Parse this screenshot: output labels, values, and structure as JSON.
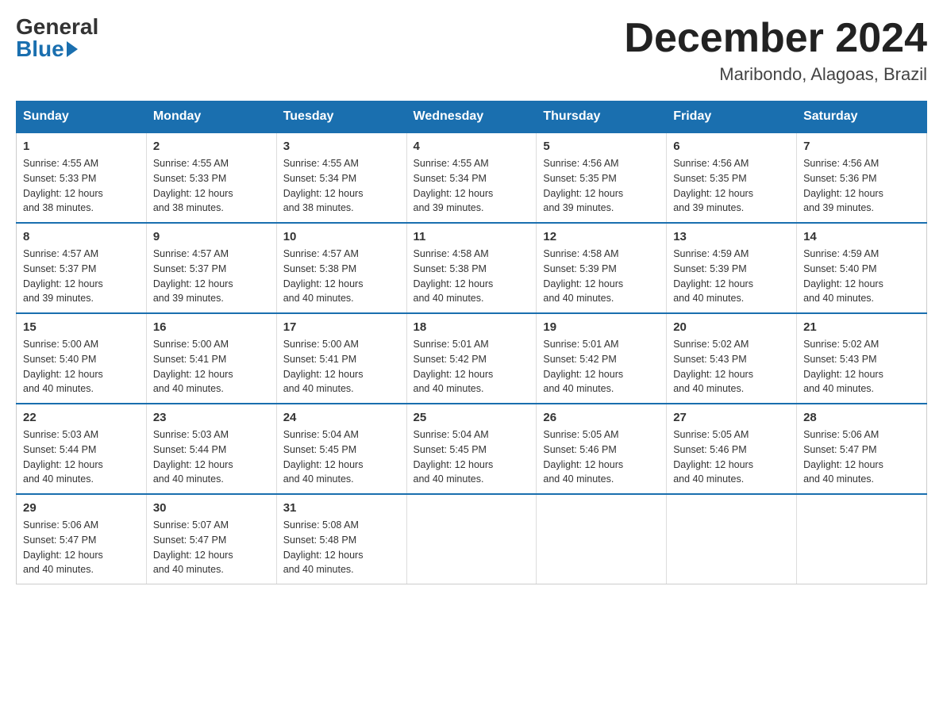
{
  "header": {
    "logo_general": "General",
    "logo_blue": "Blue",
    "main_title": "December 2024",
    "subtitle": "Maribondo, Alagoas, Brazil"
  },
  "days_of_week": [
    "Sunday",
    "Monday",
    "Tuesday",
    "Wednesday",
    "Thursday",
    "Friday",
    "Saturday"
  ],
  "weeks": [
    [
      {
        "day": "1",
        "sunrise": "4:55 AM",
        "sunset": "5:33 PM",
        "daylight": "12 hours and 38 minutes."
      },
      {
        "day": "2",
        "sunrise": "4:55 AM",
        "sunset": "5:33 PM",
        "daylight": "12 hours and 38 minutes."
      },
      {
        "day": "3",
        "sunrise": "4:55 AM",
        "sunset": "5:34 PM",
        "daylight": "12 hours and 38 minutes."
      },
      {
        "day": "4",
        "sunrise": "4:55 AM",
        "sunset": "5:34 PM",
        "daylight": "12 hours and 39 minutes."
      },
      {
        "day": "5",
        "sunrise": "4:56 AM",
        "sunset": "5:35 PM",
        "daylight": "12 hours and 39 minutes."
      },
      {
        "day": "6",
        "sunrise": "4:56 AM",
        "sunset": "5:35 PM",
        "daylight": "12 hours and 39 minutes."
      },
      {
        "day": "7",
        "sunrise": "4:56 AM",
        "sunset": "5:36 PM",
        "daylight": "12 hours and 39 minutes."
      }
    ],
    [
      {
        "day": "8",
        "sunrise": "4:57 AM",
        "sunset": "5:37 PM",
        "daylight": "12 hours and 39 minutes."
      },
      {
        "day": "9",
        "sunrise": "4:57 AM",
        "sunset": "5:37 PM",
        "daylight": "12 hours and 39 minutes."
      },
      {
        "day": "10",
        "sunrise": "4:57 AM",
        "sunset": "5:38 PM",
        "daylight": "12 hours and 40 minutes."
      },
      {
        "day": "11",
        "sunrise": "4:58 AM",
        "sunset": "5:38 PM",
        "daylight": "12 hours and 40 minutes."
      },
      {
        "day": "12",
        "sunrise": "4:58 AM",
        "sunset": "5:39 PM",
        "daylight": "12 hours and 40 minutes."
      },
      {
        "day": "13",
        "sunrise": "4:59 AM",
        "sunset": "5:39 PM",
        "daylight": "12 hours and 40 minutes."
      },
      {
        "day": "14",
        "sunrise": "4:59 AM",
        "sunset": "5:40 PM",
        "daylight": "12 hours and 40 minutes."
      }
    ],
    [
      {
        "day": "15",
        "sunrise": "5:00 AM",
        "sunset": "5:40 PM",
        "daylight": "12 hours and 40 minutes."
      },
      {
        "day": "16",
        "sunrise": "5:00 AM",
        "sunset": "5:41 PM",
        "daylight": "12 hours and 40 minutes."
      },
      {
        "day": "17",
        "sunrise": "5:00 AM",
        "sunset": "5:41 PM",
        "daylight": "12 hours and 40 minutes."
      },
      {
        "day": "18",
        "sunrise": "5:01 AM",
        "sunset": "5:42 PM",
        "daylight": "12 hours and 40 minutes."
      },
      {
        "day": "19",
        "sunrise": "5:01 AM",
        "sunset": "5:42 PM",
        "daylight": "12 hours and 40 minutes."
      },
      {
        "day": "20",
        "sunrise": "5:02 AM",
        "sunset": "5:43 PM",
        "daylight": "12 hours and 40 minutes."
      },
      {
        "day": "21",
        "sunrise": "5:02 AM",
        "sunset": "5:43 PM",
        "daylight": "12 hours and 40 minutes."
      }
    ],
    [
      {
        "day": "22",
        "sunrise": "5:03 AM",
        "sunset": "5:44 PM",
        "daylight": "12 hours and 40 minutes."
      },
      {
        "day": "23",
        "sunrise": "5:03 AM",
        "sunset": "5:44 PM",
        "daylight": "12 hours and 40 minutes."
      },
      {
        "day": "24",
        "sunrise": "5:04 AM",
        "sunset": "5:45 PM",
        "daylight": "12 hours and 40 minutes."
      },
      {
        "day": "25",
        "sunrise": "5:04 AM",
        "sunset": "5:45 PM",
        "daylight": "12 hours and 40 minutes."
      },
      {
        "day": "26",
        "sunrise": "5:05 AM",
        "sunset": "5:46 PM",
        "daylight": "12 hours and 40 minutes."
      },
      {
        "day": "27",
        "sunrise": "5:05 AM",
        "sunset": "5:46 PM",
        "daylight": "12 hours and 40 minutes."
      },
      {
        "day": "28",
        "sunrise": "5:06 AM",
        "sunset": "5:47 PM",
        "daylight": "12 hours and 40 minutes."
      }
    ],
    [
      {
        "day": "29",
        "sunrise": "5:06 AM",
        "sunset": "5:47 PM",
        "daylight": "12 hours and 40 minutes."
      },
      {
        "day": "30",
        "sunrise": "5:07 AM",
        "sunset": "5:47 PM",
        "daylight": "12 hours and 40 minutes."
      },
      {
        "day": "31",
        "sunrise": "5:08 AM",
        "sunset": "5:48 PM",
        "daylight": "12 hours and 40 minutes."
      },
      null,
      null,
      null,
      null
    ]
  ],
  "labels": {
    "sunrise": "Sunrise:",
    "sunset": "Sunset:",
    "daylight": "Daylight: 12 hours"
  }
}
